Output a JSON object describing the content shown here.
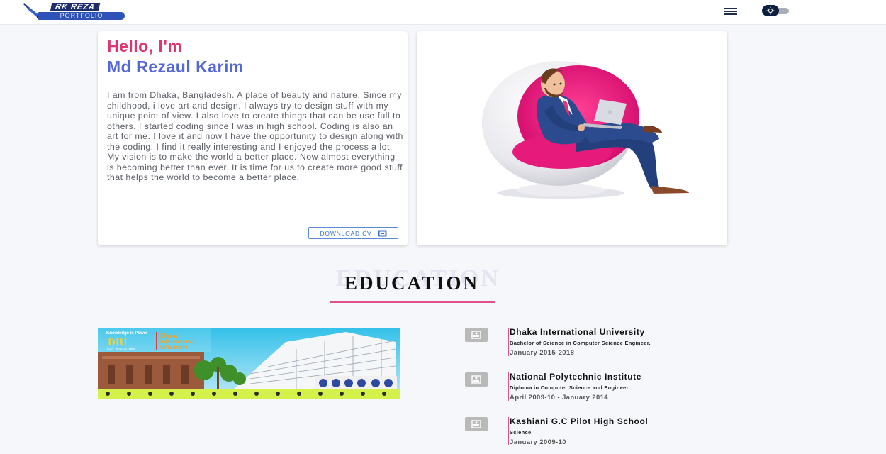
{
  "header": {
    "logo_top": "RK REZA",
    "logo_bottom": "PORTFOLIO",
    "menu_icon": "hamburger-menu-icon",
    "theme_icon": "sun-icon"
  },
  "intro": {
    "greeting": "Hello, I'm",
    "name": "Md Rezaul Karim",
    "bio": "I am from Dhaka, Bangladesh. A place of beauty and nature. Since my childhood, i love art and design. I always try to design stuff with my unique point of view. I also love to create things that can be use full to others. I started coding since I was in high school. Coding is also an art for me. I love it and now I have the opportunity to design along with the coding. I find it really interesting and I enjoyed the process a lot. My vision is to make the world a better place. Now almost everything is becoming better than ever. It is time for us to create more good stuff that helps the world to become a better place.",
    "cv_button": "DOWNLOAD CV",
    "cv_icon": "download-icon"
  },
  "education": {
    "title": "EDUCATION",
    "banner": {
      "motto": "Knowledge is Power",
      "short": "DIU",
      "name_line1": "Dhaka",
      "name_line2": "International",
      "name_line3": "University",
      "estd": "Estd. 7th April, 1995"
    },
    "items": [
      {
        "institution": "Dhaka International University",
        "degree": "Bachelor of Science in Computer Science Engineer.",
        "period": "January 2015-2018"
      },
      {
        "institution": "National Polytechnic Institute",
        "degree": "Diploma in Computer Science and Engineer",
        "period": "April 2009-10 - January 2014"
      },
      {
        "institution": "Kashiani G.C Pilot High School",
        "degree": "Science",
        "period": "January 2009-10"
      }
    ]
  },
  "colors": {
    "accent_pink": "#e0356f",
    "accent_blue": "#5567d9",
    "button_blue": "#3b72cf"
  }
}
